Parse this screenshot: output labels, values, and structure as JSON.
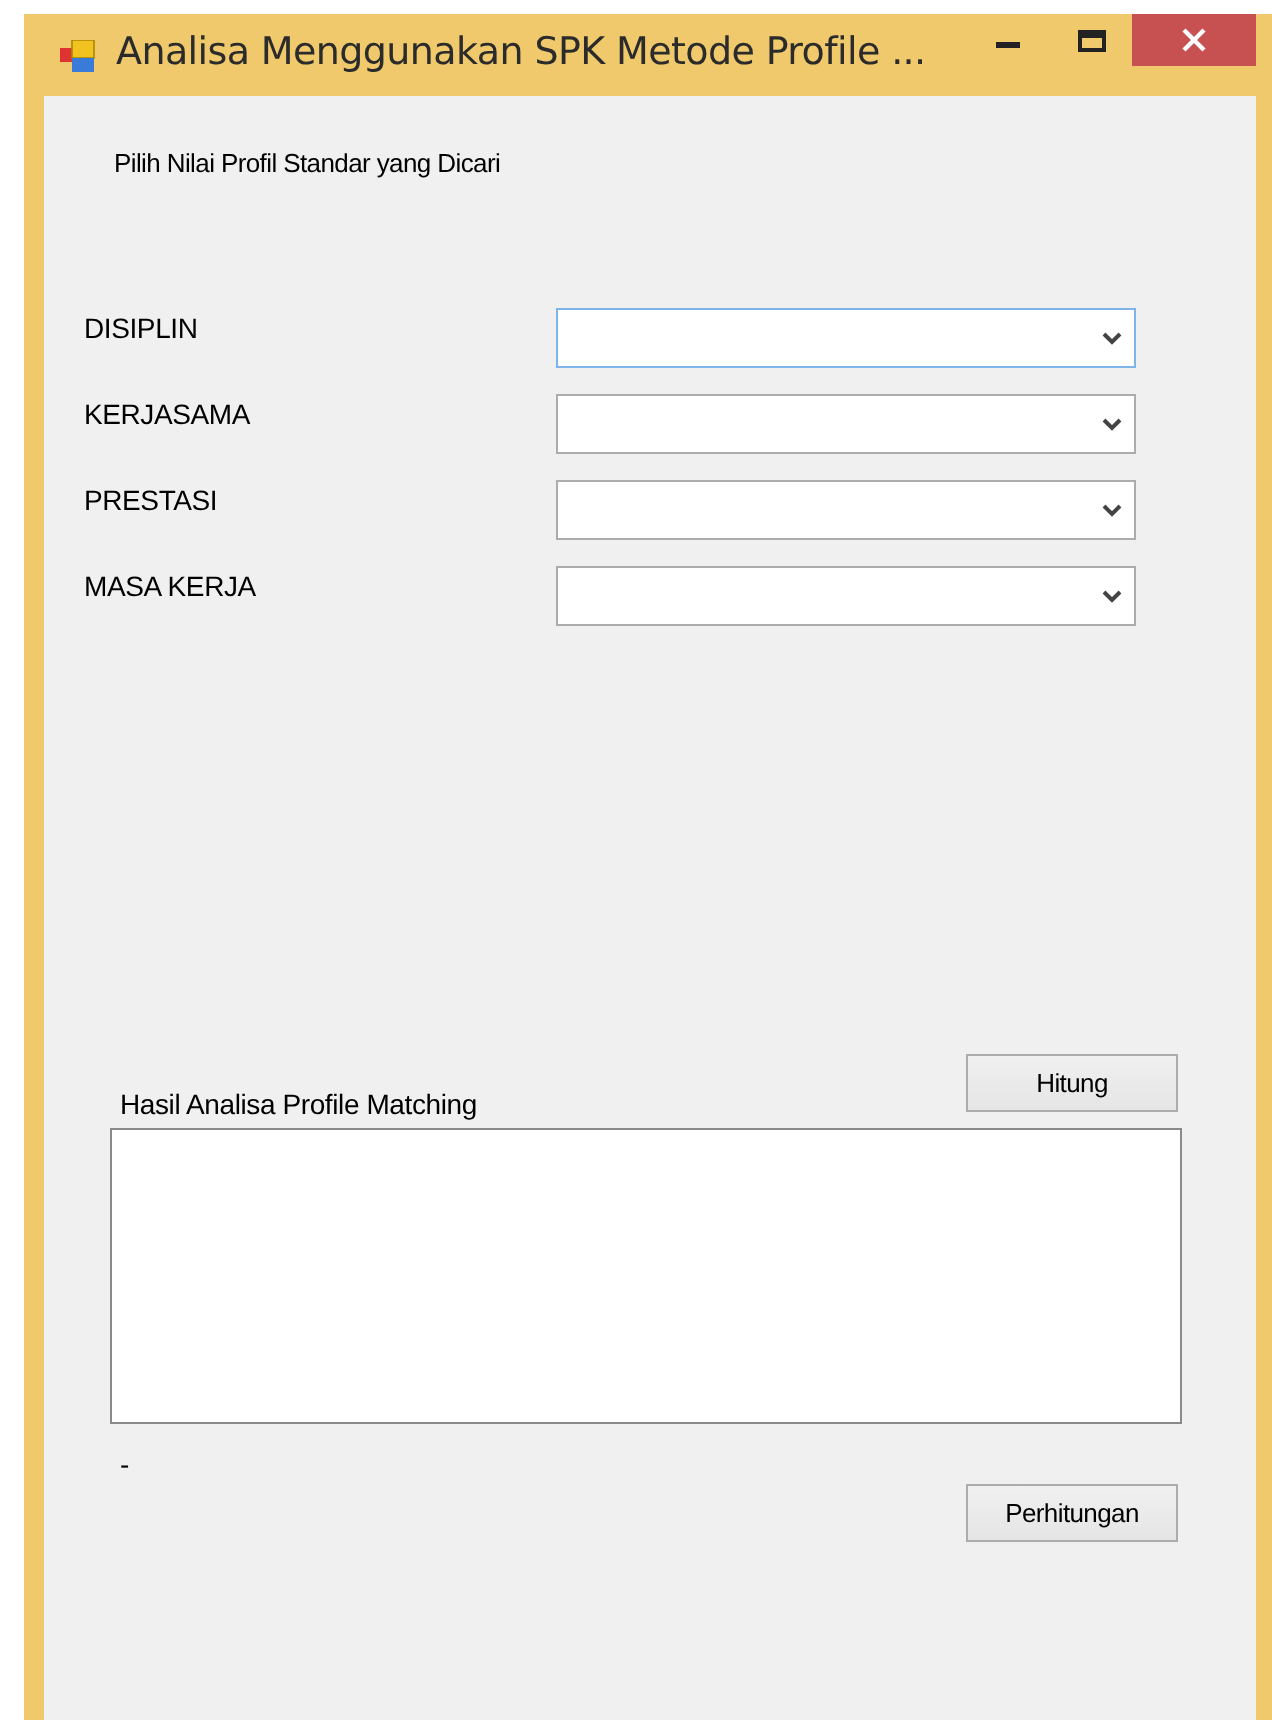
{
  "window": {
    "title": "Analisa Menggunakan SPK Metode Profile ..."
  },
  "instruction": "Pilih Nilai Profil Standar yang Dicari",
  "criteria": [
    {
      "label": "DISIPLIN",
      "focused": true
    },
    {
      "label": "KERJASAMA",
      "focused": false
    },
    {
      "label": "PRESTASI",
      "focused": false
    },
    {
      "label": "MASA KERJA",
      "focused": false
    }
  ],
  "calculate_button": "Hitung",
  "result": {
    "label": "Hasil Analisa Profile Matching"
  },
  "status_text": "-",
  "details_button": "Perhitungan"
}
